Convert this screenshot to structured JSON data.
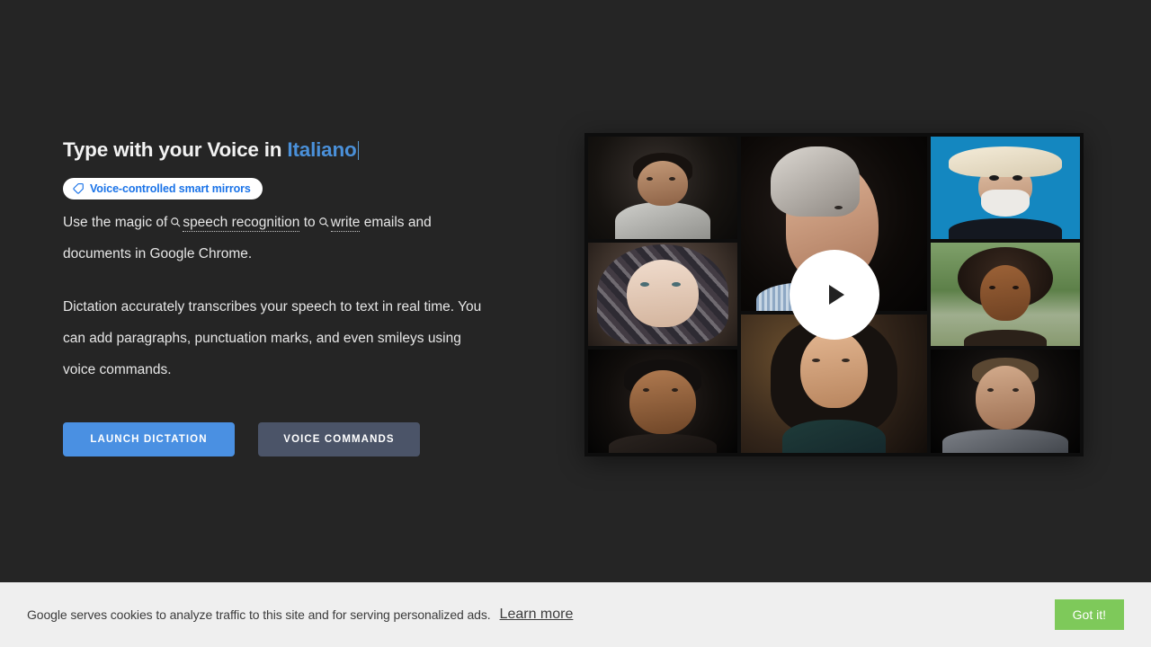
{
  "hero": {
    "headline_prefix": "Type with your Voice in ",
    "headline_language": "Italiano",
    "badge": {
      "icon": "tag-icon",
      "label": "Voice-controlled smart mirrors"
    },
    "paragraph1": {
      "part1": "Use the magic of",
      "term1": "speech recognition",
      "part2": "to",
      "term2": "write",
      "part3": "emails and documents in Google Chrome.",
      "term_icon": "search-icon"
    },
    "paragraph2": "Dictation accurately transcribes your speech to text in real time. You can add paragraphs, punctuation marks, and even smileys using voice commands.",
    "buttons": {
      "primary": "LAUNCH DICTATION",
      "secondary": "VOICE COMMANDS"
    }
  },
  "video": {
    "play_icon": "play-icon",
    "tiles": [
      {
        "id": "tile-1",
        "alt": "portrait-man-dark-background"
      },
      {
        "id": "tile-2",
        "alt": "portrait-woman-headscarf"
      },
      {
        "id": "tile-3",
        "alt": "portrait-smiling-bearded-man"
      },
      {
        "id": "tile-4",
        "alt": "portrait-elderly-man-profile"
      },
      {
        "id": "tile-5",
        "alt": "portrait-woman-dark-hair"
      },
      {
        "id": "tile-6",
        "alt": "portrait-man-cowboy-hat"
      },
      {
        "id": "tile-7",
        "alt": "portrait-woman-curly-hair"
      },
      {
        "id": "tile-8",
        "alt": "portrait-blond-man"
      }
    ]
  },
  "cookie": {
    "message": "Google serves cookies to analyze traffic to this site and for serving personalized ads.",
    "link": "Learn more",
    "accept": "Got it!"
  },
  "colors": {
    "page_background": "#252525",
    "accent_blue": "#4a90e2",
    "headline_language": "#4a90d9",
    "badge_text": "#1a73e8",
    "secondary_button": "#4b5468",
    "cookie_background": "#efefef",
    "cookie_accept": "#7ec95a"
  }
}
